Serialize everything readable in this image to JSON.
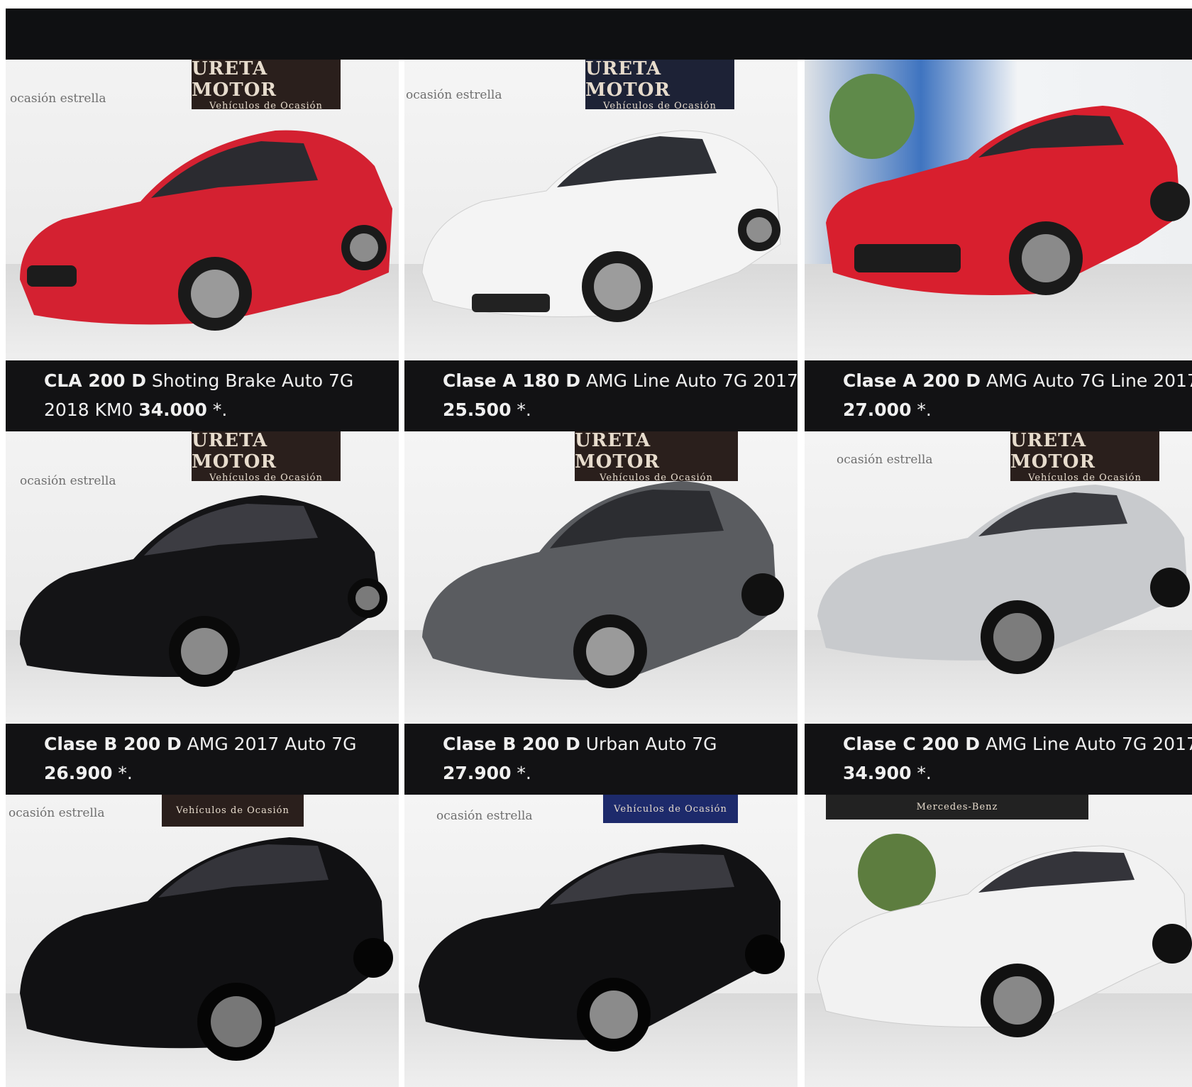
{
  "listings": [
    {
      "model": "CLA 200 D",
      "desc": " Shoting Brake Auto 7G",
      "line2": "2018 KM0 ",
      "price": "34.000",
      "suffix": "  *.",
      "color": "#d42131"
    },
    {
      "model": "Clase A 180 D",
      "desc": " AMG Line Auto 7G 2017",
      "line2": "",
      "price": "25.500",
      "suffix": "  *.",
      "color": "#f4f4f4"
    },
    {
      "model": "Clase A 200 D",
      "desc": " AMG Auto 7G Line 2017",
      "line2": "",
      "price": "27.000",
      "suffix": "  *.",
      "color": "#d81f2e"
    },
    {
      "model": "Clase B 200 D",
      "desc": " AMG 2017 Auto 7G",
      "line2": "",
      "price": "26.900",
      "suffix": "  *.",
      "color": "#141416"
    },
    {
      "model": "Clase B 200 D",
      "desc": " Urban Auto 7G",
      "line2": "",
      "price": "27.900",
      "suffix": "  *.",
      "color": "#5a5c60"
    },
    {
      "model": "Clase C 200 D",
      "desc": " AMG Line Auto 7G 2017",
      "line2": "",
      "price": "34.900",
      "suffix": "  *.",
      "color": "#c8cacd"
    },
    {
      "color": "#111113"
    },
    {
      "color": "#121214"
    },
    {
      "color": "#f2f2f2"
    }
  ],
  "wall_text": {
    "brand": "ocasión estrella",
    "dealer": "URETA MOTOR",
    "dealer_sub": "Vehículos de Ocasión",
    "maker": "Mercedes-Benz"
  }
}
